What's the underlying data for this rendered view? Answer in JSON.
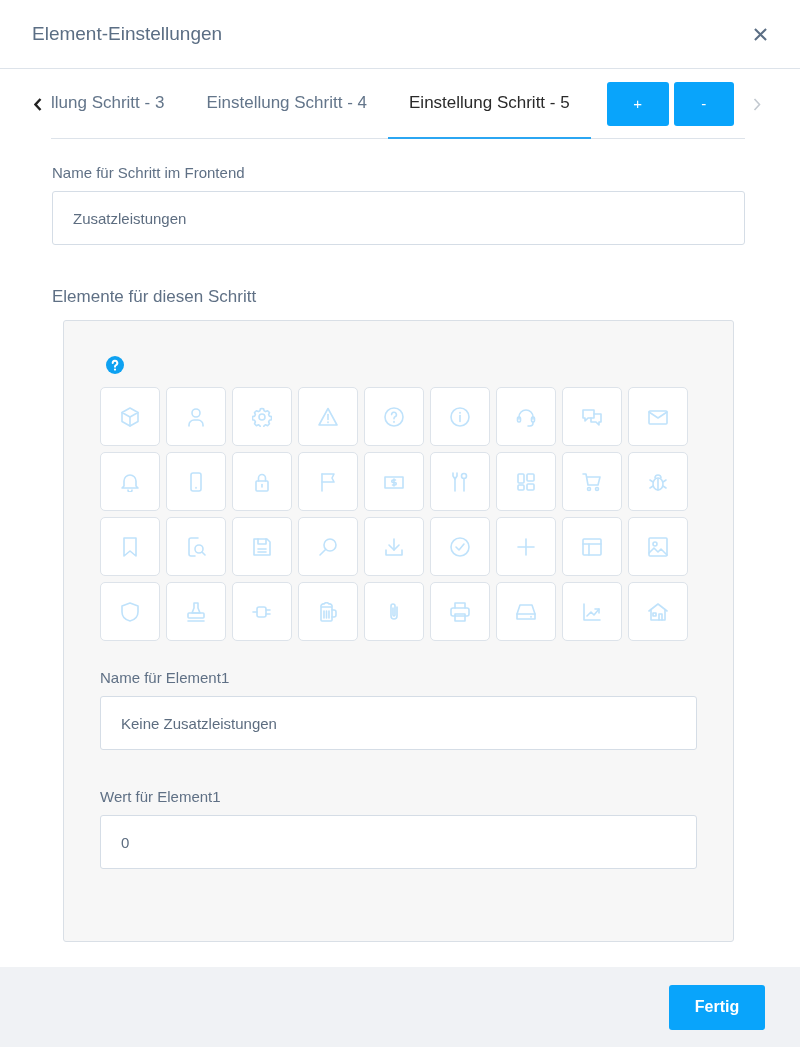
{
  "dialog": {
    "title": "Element-Einstellungen"
  },
  "tab_bar": {
    "left_arrow": {
      "disabled": false
    },
    "tabs": [
      {
        "label": "llung Schritt - 3",
        "selected": false
      },
      {
        "label": "Einstellung Schritt - 4",
        "selected": false
      },
      {
        "label": "Einstellung Schritt - 5",
        "selected": true
      }
    ],
    "buttons": [
      "+",
      "-"
    ],
    "right_arrow": {
      "disabled": true
    }
  },
  "step_name": {
    "label": "Name für Schritt im Frontend",
    "value": "Zusatzleistungen"
  },
  "elements": {
    "title": "Elemente für diesen Schritt",
    "icon_tiles": [
      {
        "kind": "cube"
      },
      {
        "kind": "user"
      },
      {
        "kind": "gear"
      },
      {
        "kind": "warning"
      },
      {
        "kind": "question"
      },
      {
        "kind": "info"
      },
      {
        "kind": "headset"
      },
      {
        "kind": "chat"
      },
      {
        "kind": "mail"
      },
      {
        "kind": "bell"
      },
      {
        "kind": "phone"
      },
      {
        "kind": "lock"
      },
      {
        "kind": "flag"
      },
      {
        "kind": "banknote"
      },
      {
        "kind": "tools"
      },
      {
        "kind": "apps"
      },
      {
        "kind": "cart"
      },
      {
        "kind": "bug"
      },
      {
        "kind": "bookmark"
      },
      {
        "kind": "filesearch"
      },
      {
        "kind": "floppy"
      },
      {
        "kind": "search"
      },
      {
        "kind": "download"
      },
      {
        "kind": "check"
      },
      {
        "kind": "plus"
      },
      {
        "kind": "layout"
      },
      {
        "kind": "image"
      },
      {
        "kind": "shield"
      },
      {
        "kind": "stamp"
      },
      {
        "kind": "plug"
      },
      {
        "kind": "beer"
      },
      {
        "kind": "paperclip"
      },
      {
        "kind": "printer"
      },
      {
        "kind": "drive"
      },
      {
        "kind": "chart"
      },
      {
        "kind": "house"
      }
    ],
    "fields": [
      {
        "label": "Name für Element1",
        "value": "Keine Zusatzleistungen"
      },
      {
        "label": "Wert für Element1",
        "value": "0"
      }
    ]
  },
  "footer": {
    "done_button": "Fertig"
  }
}
